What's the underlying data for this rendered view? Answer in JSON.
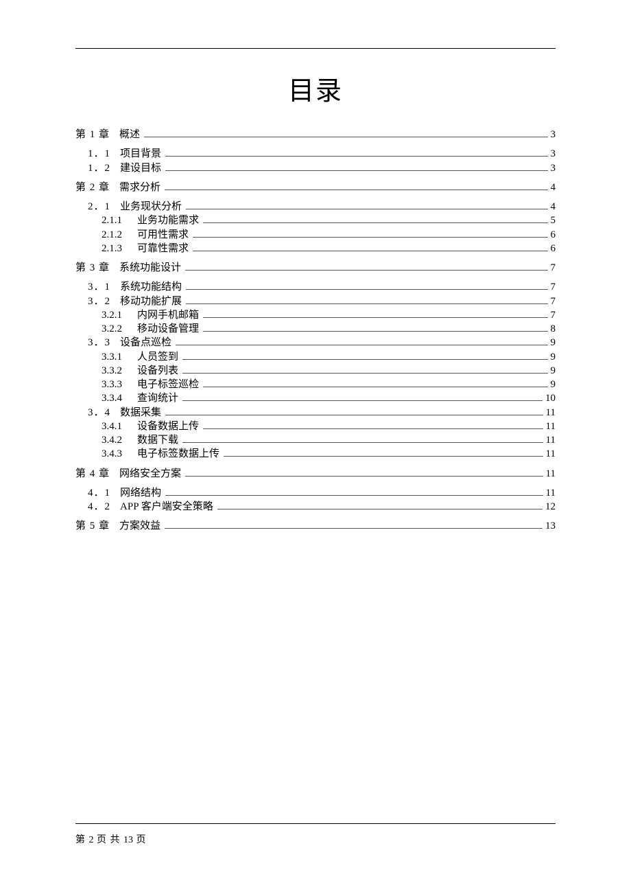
{
  "title": "目录",
  "entries": [
    {
      "level": 1,
      "gap": false,
      "num": "第 1 章",
      "txt": "概述",
      "page": "3"
    },
    {
      "level": 2,
      "gap": true,
      "num": "1．1",
      "txt": "项目背景",
      "page": "3"
    },
    {
      "level": 2,
      "gap": false,
      "num": "1．2",
      "txt": "建设目标",
      "page": "3"
    },
    {
      "level": 1,
      "gap": true,
      "num": "第 2 章",
      "txt": "需求分析",
      "page": "4"
    },
    {
      "level": 2,
      "gap": true,
      "num": "2．1",
      "txt": "业务现状分析",
      "page": "4"
    },
    {
      "level": 3,
      "gap": false,
      "num": "2.1.1",
      "txt": "业务功能需求",
      "page": "5"
    },
    {
      "level": 3,
      "gap": false,
      "num": "2.1.2",
      "txt": "可用性需求",
      "page": "6"
    },
    {
      "level": 3,
      "gap": false,
      "num": "2.1.3",
      "txt": "可靠性需求",
      "page": "6"
    },
    {
      "level": 1,
      "gap": true,
      "num": "第 3 章",
      "txt": "系统功能设计",
      "page": "7"
    },
    {
      "level": 2,
      "gap": true,
      "num": "3．1",
      "txt": "系统功能结构",
      "page": "7"
    },
    {
      "level": 2,
      "gap": false,
      "num": "3．2",
      "txt": "移动功能扩展",
      "page": "7"
    },
    {
      "level": 3,
      "gap": false,
      "num": "3.2.1",
      "txt": "内网手机邮箱",
      "page": "7"
    },
    {
      "level": 3,
      "gap": false,
      "num": "3.2.2",
      "txt": "移动设备管理",
      "page": "8"
    },
    {
      "level": 2,
      "gap": false,
      "num": "3．3",
      "txt": "设备点巡检",
      "page": "9"
    },
    {
      "level": 3,
      "gap": false,
      "num": "3.3.1",
      "txt": "人员签到",
      "page": "9"
    },
    {
      "level": 3,
      "gap": false,
      "num": "3.3.2",
      "txt": "设备列表",
      "page": "9"
    },
    {
      "level": 3,
      "gap": false,
      "num": "3.3.3",
      "txt": "电子标签巡检",
      "page": "9"
    },
    {
      "level": 3,
      "gap": false,
      "num": "3.3.4",
      "txt": "查询统计",
      "page": "10"
    },
    {
      "level": 2,
      "gap": false,
      "num": "3．4",
      "txt": "数据采集",
      "page": "11"
    },
    {
      "level": 3,
      "gap": false,
      "num": "3.4.1",
      "txt": "设备数据上传",
      "page": "11"
    },
    {
      "level": 3,
      "gap": false,
      "num": "3.4.2",
      "txt": "数据下载",
      "page": "11"
    },
    {
      "level": 3,
      "gap": false,
      "num": "3.4.3",
      "txt": "电子标签数据上传",
      "page": "11"
    },
    {
      "level": 1,
      "gap": true,
      "num": "第 4 章",
      "txt": "网络安全方案",
      "page": "11"
    },
    {
      "level": 2,
      "gap": true,
      "num": "4．1",
      "txt": "网络结构",
      "page": "11"
    },
    {
      "level": 2,
      "gap": false,
      "num": "4．2",
      "txt": "APP 客户端安全策略",
      "page": "12"
    },
    {
      "level": 1,
      "gap": true,
      "num": "第 5 章",
      "txt": "方案效益",
      "page": "13"
    }
  ],
  "footer": {
    "prefix": "第 ",
    "current": "2",
    "mid": " 页 共 ",
    "total": "13",
    "suffix": " 页"
  }
}
